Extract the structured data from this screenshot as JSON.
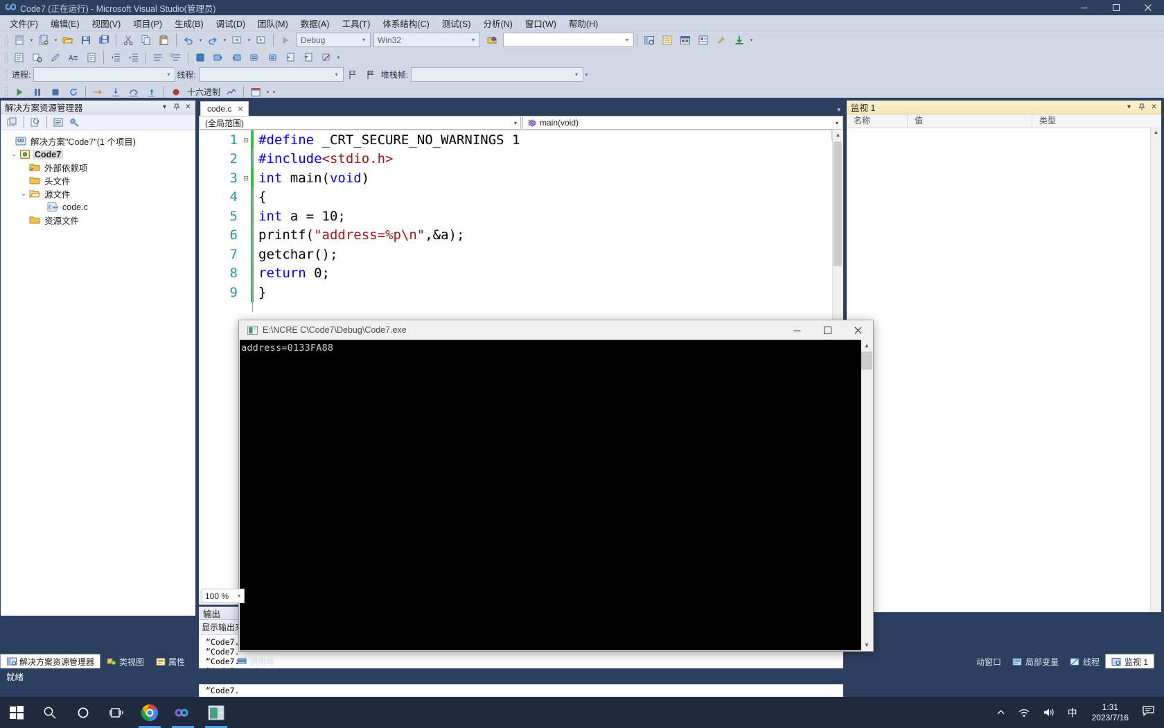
{
  "window": {
    "title": "Code7 (正在运行) - Microsoft Visual Studio(管理员)",
    "logo_icon": "infinity-icon",
    "minimize_label": "—",
    "maximize_label": "▫",
    "close_label": "✕"
  },
  "menubar": {
    "items": [
      {
        "label": "文件(F)",
        "name": "menu-file"
      },
      {
        "label": "编辑(E)",
        "name": "menu-edit"
      },
      {
        "label": "视图(V)",
        "name": "menu-view"
      },
      {
        "label": "项目(P)",
        "name": "menu-project"
      },
      {
        "label": "生成(B)",
        "name": "menu-build"
      },
      {
        "label": "调试(D)",
        "name": "menu-debug"
      },
      {
        "label": "团队(M)",
        "name": "menu-team"
      },
      {
        "label": "数据(A)",
        "name": "menu-data"
      },
      {
        "label": "工具(T)",
        "name": "menu-tools"
      },
      {
        "label": "体系结构(C)",
        "name": "menu-architecture"
      },
      {
        "label": "测试(S)",
        "name": "menu-test"
      },
      {
        "label": "分析(N)",
        "name": "menu-analyze"
      },
      {
        "label": "窗口(W)",
        "name": "menu-window"
      },
      {
        "label": "帮助(H)",
        "name": "menu-help"
      }
    ]
  },
  "toolbar": {
    "config_value": "Debug",
    "platform_value": "Win32",
    "search_value": "",
    "start_label": "▶",
    "hex_label": "十六进制"
  },
  "debug_toolbar": {
    "process_label": "进程:",
    "process_value": "",
    "thread_label": "线程:",
    "thread_value": "",
    "stackframe_label": "堆栈帧:",
    "stackframe_value": ""
  },
  "solution_explorer": {
    "title": "解决方案资源管理器",
    "tree": [
      {
        "label": "解决方案\"Code7\"(1 个项目)",
        "icon": "solution-icon",
        "indent": 0,
        "twisty": "",
        "selected": false
      },
      {
        "label": "Code7",
        "icon": "project-icon",
        "indent": 1,
        "twisty": "⌄",
        "selected": true
      },
      {
        "label": "外部依赖项",
        "icon": "folder-dep-icon",
        "indent": 2,
        "twisty": "",
        "selected": false
      },
      {
        "label": "头文件",
        "icon": "folder-icon",
        "indent": 2,
        "twisty": "",
        "selected": false
      },
      {
        "label": "源文件",
        "icon": "folder-open-icon",
        "indent": 2,
        "twisty": "⌄",
        "selected": false
      },
      {
        "label": "code.c",
        "icon": "c-file-icon",
        "indent": 3,
        "twisty": "",
        "selected": false
      },
      {
        "label": "资源文件",
        "icon": "folder-icon",
        "indent": 2,
        "twisty": "",
        "selected": false
      }
    ]
  },
  "editor": {
    "tab_label": "code.c",
    "tab_close": "✕",
    "scope_value": "(全局范围)",
    "member_value": "main(void)",
    "zoom_value": "100 %",
    "lines": [
      {
        "n": "1",
        "fold": "⊟",
        "changed": true,
        "tokens": [
          {
            "t": "#define",
            "c": "pp"
          },
          {
            "t": " _CRT_SECURE_NO_WARNINGS 1",
            "c": "plain"
          }
        ]
      },
      {
        "n": "2",
        "fold": "",
        "changed": true,
        "tokens": [
          {
            "t": "#include",
            "c": "pp"
          },
          {
            "t": "<stdio.h>",
            "c": "hdr"
          }
        ]
      },
      {
        "n": "3",
        "fold": "⊟",
        "changed": true,
        "tokens": [
          {
            "t": "int",
            "c": "kw"
          },
          {
            "t": " main(",
            "c": "plain"
          },
          {
            "t": "void",
            "c": "kw"
          },
          {
            "t": ")",
            "c": "plain"
          }
        ]
      },
      {
        "n": "4",
        "fold": "",
        "changed": true,
        "tokens": [
          {
            "t": "{",
            "c": "plain"
          }
        ]
      },
      {
        "n": "5",
        "fold": "",
        "changed": true,
        "tokens": [
          {
            "t": "int",
            "c": "kw"
          },
          {
            "t": " a = 10;",
            "c": "plain"
          }
        ]
      },
      {
        "n": "6",
        "fold": "",
        "changed": true,
        "tokens": [
          {
            "t": "printf(",
            "c": "plain"
          },
          {
            "t": "\"address=%p\\n\"",
            "c": "str"
          },
          {
            "t": ",&a);",
            "c": "plain"
          }
        ]
      },
      {
        "n": "7",
        "fold": "",
        "changed": true,
        "tokens": [
          {
            "t": "getchar();",
            "c": "plain"
          }
        ]
      },
      {
        "n": "8",
        "fold": "",
        "changed": true,
        "tokens": [
          {
            "t": "return",
            "c": "kw"
          },
          {
            "t": " 0;",
            "c": "plain"
          }
        ]
      },
      {
        "n": "9",
        "fold": "",
        "changed": true,
        "tokens": [
          {
            "t": "}",
            "c": "plain"
          }
        ]
      }
    ]
  },
  "output_panel": {
    "title": "输出",
    "source_label": "显示输出来",
    "lines": [
      "“Code7.",
      "“Code7.",
      "“Code7.",
      "“Code7.",
      "“Code7.",
      "“Code7."
    ]
  },
  "watch_panel": {
    "title": "监视 1",
    "columns": [
      "名称",
      "值",
      "类型"
    ],
    "rows": []
  },
  "dock_tabs_left": [
    {
      "label": "解决方案资源管理器",
      "icon": "solution-explorer-icon",
      "active": true
    },
    {
      "label": "类视图",
      "icon": "class-view-icon",
      "active": false
    },
    {
      "label": "属性",
      "icon": "properties-icon",
      "active": false
    }
  ],
  "dock_tabs_center": [
    {
      "label": "调用堆",
      "icon": "call-stack-icon",
      "active": false
    }
  ],
  "dock_tabs_right": [
    {
      "label": "动窗口",
      "icon": "autos-icon",
      "active": false
    },
    {
      "label": "局部变量",
      "icon": "locals-icon",
      "active": false
    },
    {
      "label": "线程",
      "icon": "threads-icon",
      "active": false
    },
    {
      "label": "监视 1",
      "icon": "watch-icon",
      "active": true
    }
  ],
  "statusbar": {
    "text": "就绪"
  },
  "console": {
    "title": "E:\\NCRE C\\Code7\\Debug\\Code7.exe",
    "icon": "console-icon",
    "minimize_label": "—",
    "maximize_label": "▢",
    "close_label": "✕",
    "output": "address=0133FA88"
  },
  "taskbar": {
    "items": [
      {
        "name": "start-button",
        "icon": "windows-icon",
        "running": false
      },
      {
        "name": "search-button",
        "icon": "search-icon",
        "running": false
      },
      {
        "name": "cortana-button",
        "icon": "cortana-icon",
        "running": false
      },
      {
        "name": "task-view-button",
        "icon": "task-view-icon",
        "running": false
      },
      {
        "name": "chrome-taskbar-button",
        "icon": "chrome-icon",
        "running": true
      },
      {
        "name": "visual-studio-taskbar-button",
        "icon": "visual-studio-icon",
        "running": true
      },
      {
        "name": "console-taskbar-button",
        "icon": "console-window-icon",
        "running": true
      }
    ],
    "tray": {
      "chevron": "⌃",
      "network_icon": "wifi-icon",
      "volume_icon": "volume-icon",
      "ime_label": "中",
      "time": "1:31",
      "date": "2023/7/16",
      "notification_icon": "notification-icon"
    }
  },
  "colors": {
    "vs_chrome": "#2d3f5f",
    "menu_bg": "#d0d7e5",
    "accent_blue": "#2b91af",
    "keyword": "#0000ff",
    "string": "#a31515",
    "change_marker": "#27c840",
    "watch_header": "#f7e7b4",
    "taskbar": "#1f2a3c"
  }
}
